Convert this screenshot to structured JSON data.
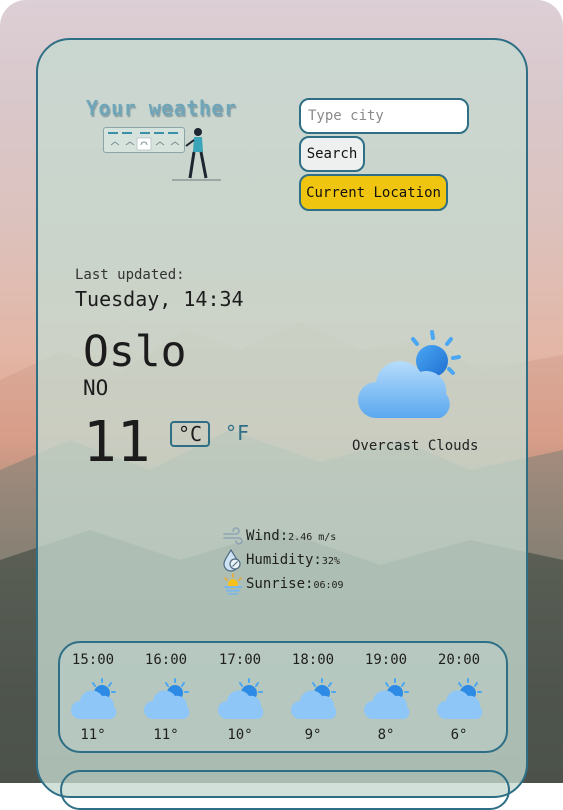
{
  "app": {
    "logo_title": "Your weather"
  },
  "search": {
    "placeholder": "Type city",
    "search_label": "Search",
    "location_label": "Current Location"
  },
  "current": {
    "last_updated_label": "Last updated:",
    "date": "Tuesday, 14:34",
    "city": "Oslo",
    "country": "NO",
    "temp": "11",
    "unit_c": "°C",
    "unit_f": "°F",
    "description": "Overcast Clouds",
    "icon": "sun-behind-cloud-icon"
  },
  "details": {
    "wind_label": "Wind:",
    "wind_value": "2.46 m/s",
    "humidity_label": "Humidity:",
    "humidity_value": "32%",
    "sunrise_label": "Sunrise:",
    "sunrise_value": "06:09"
  },
  "forecast": [
    {
      "time": "15:00",
      "temp": "11°",
      "icon": "sun-behind-cloud-icon"
    },
    {
      "time": "16:00",
      "temp": "11°",
      "icon": "sun-behind-cloud-icon"
    },
    {
      "time": "17:00",
      "temp": "10°",
      "icon": "sun-behind-cloud-icon"
    },
    {
      "time": "18:00",
      "temp": "9°",
      "icon": "sun-behind-cloud-icon"
    },
    {
      "time": "19:00",
      "temp": "8°",
      "icon": "sun-behind-cloud-icon"
    },
    {
      "time": "20:00",
      "temp": "6°",
      "icon": "sun-behind-cloud-icon"
    }
  ],
  "colors": {
    "accent": "#2e6f86",
    "button_location": "#f0c510",
    "cloud": "#7ec0f7",
    "sun": "#2d8be5"
  }
}
